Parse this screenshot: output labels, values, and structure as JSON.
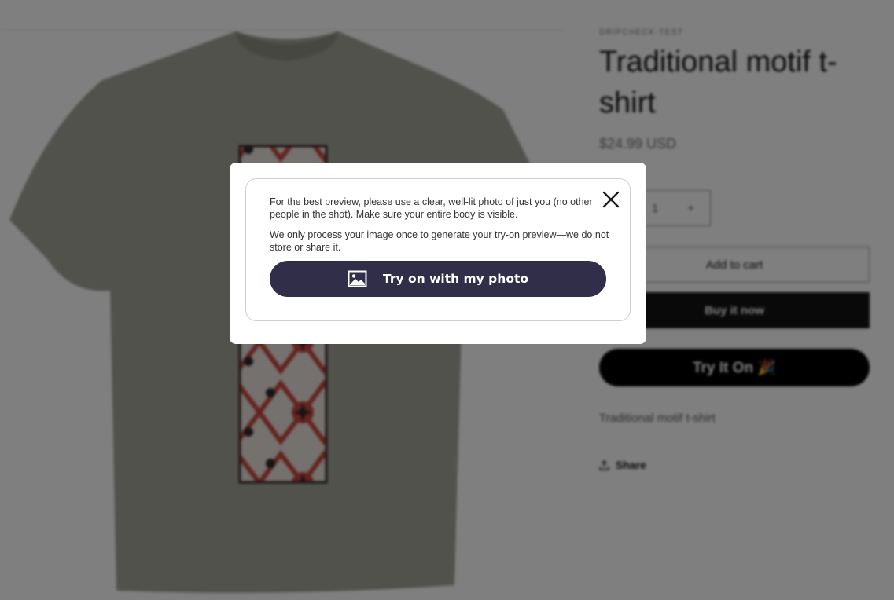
{
  "product": {
    "vendor": "DRIPCHECK-TEST",
    "title": "Traditional motif t-shirt",
    "price": "$24.99 USD",
    "quantity": "1",
    "qty_minus": "−",
    "qty_plus": "+",
    "add_to_cart": "Add to cart",
    "buy_now": "Buy it now",
    "try_it_on": "Try It On 🎉",
    "description": "Traditional motif t-shirt",
    "share": "Share"
  },
  "modal": {
    "text1": "For the best preview, please use a clear, well-lit photo of just you (no other people in the shot). Make sure your entire body is visible.",
    "text2": "We only process your image once to generate your try-on preview—we do not store or share it.",
    "button_label": "Try on with my photo",
    "button_icon": "image-icon",
    "close_icon": "close-icon"
  },
  "colors": {
    "overlay": "rgba(0,0,0,0.5)",
    "modal_button": "#302e48",
    "shirt": "#9a9b90",
    "motif_red": "#c8453a"
  }
}
